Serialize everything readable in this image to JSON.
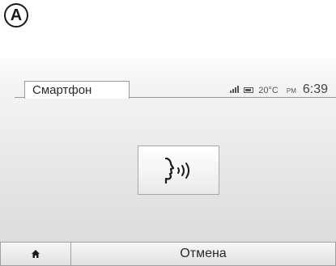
{
  "marker": {
    "label": "A"
  },
  "header": {
    "tab_label": "Смартфон",
    "status": {
      "signal_icon": "signal-bars-icon",
      "battery_icon": "battery-icon",
      "temperature": "20°C",
      "ampm": "PM",
      "time": "6:39"
    }
  },
  "main": {
    "voice_button_icon": "voice-recognition-icon"
  },
  "bottom_bar": {
    "home_icon": "home-icon",
    "cancel_label": "Отмена"
  },
  "colors": {
    "text": "#2a2a2a",
    "border": "#a0a0a0",
    "background_top": "#ffffff",
    "background_bottom": "#dcdcdc"
  }
}
